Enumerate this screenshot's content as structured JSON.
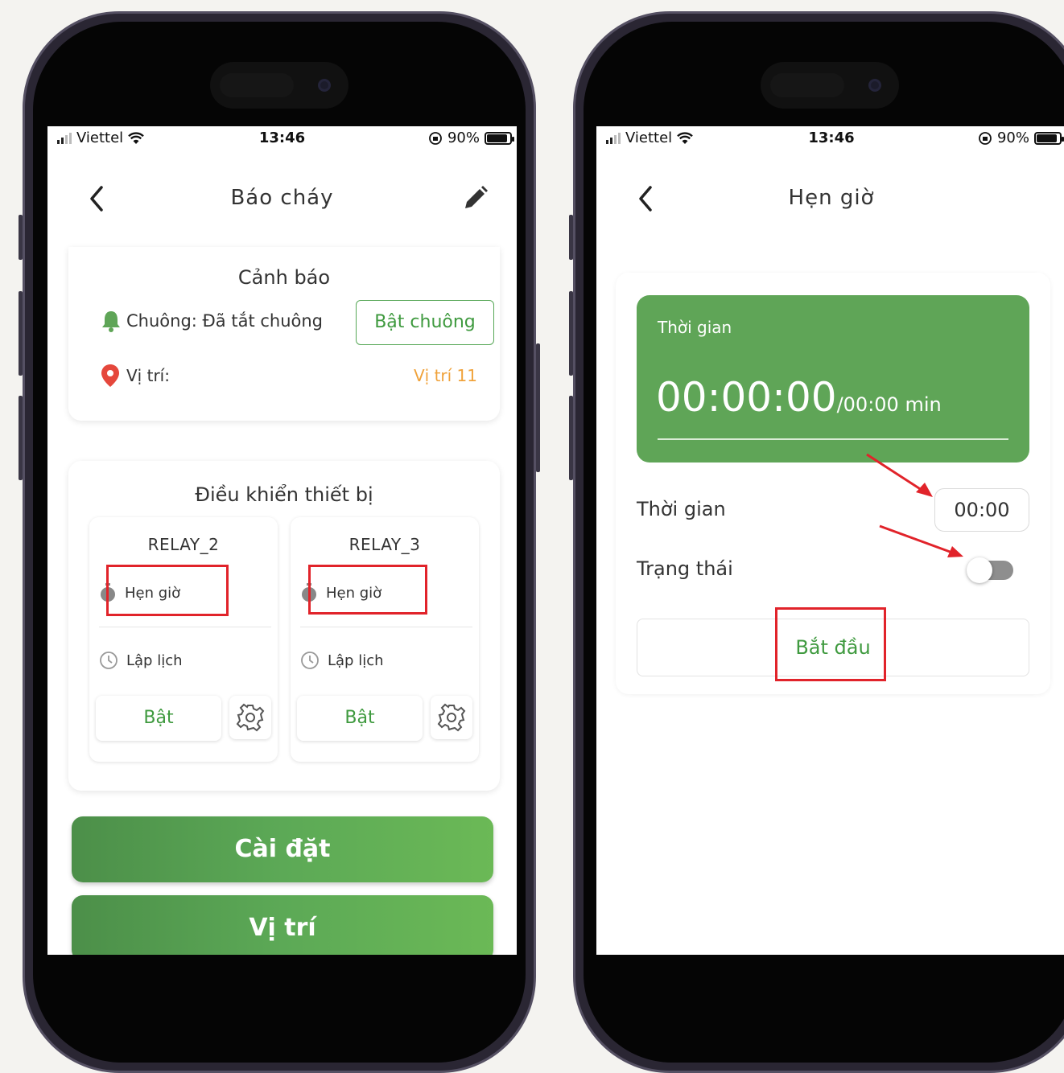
{
  "left": {
    "status": {
      "carrier": "Viettel",
      "time": "13:46",
      "battery": "90%"
    },
    "nav": {
      "title": "Báo cháy"
    },
    "alert": {
      "title": "Cảnh báo",
      "bell_label": "Chuông: Đã tắt chuông",
      "bell_button": "Bật chuông",
      "location_label": "Vị trí:",
      "location_value": "Vị trí 11"
    },
    "control": {
      "title": "Điều khiển thiết bị",
      "relays": [
        {
          "name": "RELAY_2",
          "timer": "Hẹn giờ",
          "schedule": "Lập lịch",
          "on": "Bật"
        },
        {
          "name": "RELAY_3",
          "timer": "Hẹn giờ",
          "schedule": "Lập lịch",
          "on": "Bật"
        }
      ]
    },
    "buttons": {
      "settings": "Cài đặt",
      "location": "Vị trí"
    }
  },
  "right": {
    "status": {
      "carrier": "Viettel",
      "time": "13:46",
      "battery": "90%"
    },
    "nav": {
      "title": "Hẹn giờ"
    },
    "timer": {
      "label": "Thời gian",
      "value": "00:00:00",
      "suffix": "/00:00 min"
    },
    "time_row": {
      "label": "Thời gian",
      "value": "00:00"
    },
    "state_row": {
      "label": "Trạng thái",
      "enabled": false
    },
    "start_button": "Bắt đầu"
  },
  "colors": {
    "accent_green": "#5fa557",
    "highlight_red": "#e1232a",
    "location_orange": "#f0a23a",
    "pin_red": "#e5473c"
  },
  "icons": [
    "back-chevron-icon",
    "pencil-icon",
    "bell-icon",
    "location-pin-icon",
    "stopwatch-icon",
    "clock-icon",
    "gear-icon",
    "wifi-icon",
    "signal-icon",
    "battery-icon",
    "orientation-lock-icon",
    "red-arrow-icon"
  ]
}
